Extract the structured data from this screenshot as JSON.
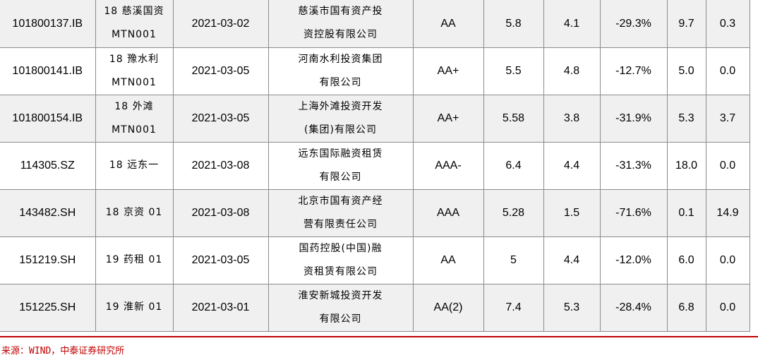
{
  "table": {
    "rows": [
      [
        "101800137.IB",
        "18 慈溪国资\nMTN001",
        "2021-03-02",
        "慈溪市国有资产投\n资控股有限公司",
        "AA",
        "5.8",
        "4.1",
        "-29.3%",
        "9.7",
        "0.3"
      ],
      [
        "101800141.IB",
        "18 豫水利\nMTN001",
        "2021-03-05",
        "河南水利投资集团\n有限公司",
        "AA+",
        "5.5",
        "4.8",
        "-12.7%",
        "5.0",
        "0.0"
      ],
      [
        "101800154.IB",
        "18 外滩\nMTN001",
        "2021-03-05",
        "上海外滩投资开发\n(集团)有限公司",
        "AA+",
        "5.58",
        "3.8",
        "-31.9%",
        "5.3",
        "3.7"
      ],
      [
        "114305.SZ",
        "18 远东一",
        "2021-03-08",
        "远东国际融资租赁\n有限公司",
        "AAA-",
        "6.4",
        "4.4",
        "-31.3%",
        "18.0",
        "0.0"
      ],
      [
        "143482.SH",
        "18 京资 01",
        "2021-03-08",
        "北京市国有资产经\n营有限责任公司",
        "AAA",
        "5.28",
        "1.5",
        "-71.6%",
        "0.1",
        "14.9"
      ],
      [
        "151219.SH",
        "19 药租 01",
        "2021-03-05",
        "国药控股(中国)融\n资租赁有限公司",
        "AA",
        "5",
        "4.4",
        "-12.0%",
        "6.0",
        "0.0"
      ],
      [
        "151225.SH",
        "19 淮新 01",
        "2021-03-01",
        "淮安新城投资开发\n有限公司",
        "AA(2)",
        "7.4",
        "5.3",
        "-28.4%",
        "6.8",
        "0.0"
      ]
    ]
  },
  "source": "来源：WIND，中泰证券研究所",
  "colors": {
    "accent": "#c00000",
    "row_shade": "#f0f0f0",
    "grid": "#8c8c8c"
  }
}
